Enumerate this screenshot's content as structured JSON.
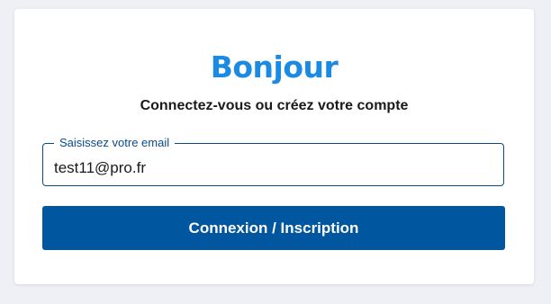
{
  "card": {
    "title": "Bonjour",
    "subtitle": "Connectez-vous ou créez votre compte"
  },
  "email_field": {
    "label": "Saisissez votre email",
    "value": "test11@pro.fr"
  },
  "submit_button": {
    "label": "Connexion / Inscription"
  },
  "colors": {
    "brand": "#1b8ae3",
    "primary_button": "#00569f",
    "field_border": "#0a4a8a",
    "background": "#eef0f5"
  }
}
